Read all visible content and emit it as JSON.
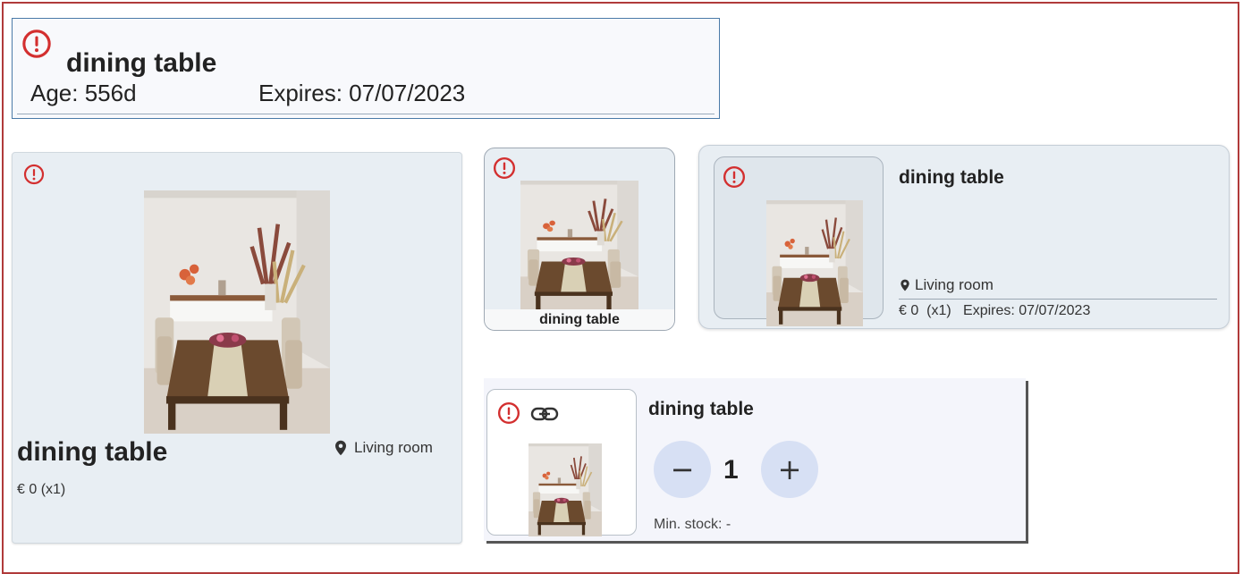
{
  "colors": {
    "alert": "#d32f2f",
    "accent": "#d7e0f4"
  },
  "header": {
    "title": "dining table",
    "age": "Age: 556d",
    "expires": "Expires: 07/07/2023"
  },
  "card_large": {
    "title": "dining table",
    "location": "Living room",
    "price": "€ 0  (x1)",
    "icons": [
      "alert-icon",
      "location-pin-icon"
    ]
  },
  "card_small": {
    "caption": "dining table",
    "icons": [
      "alert-icon"
    ]
  },
  "card_wide": {
    "title": "dining table",
    "location": "Living room",
    "meta": "€ 0  (x1)   Expires: 07/07/2023",
    "icons": [
      "alert-icon",
      "location-pin-icon"
    ]
  },
  "card_stock": {
    "title": "dining table",
    "decrement": "−",
    "quantity": "1",
    "increment": "+",
    "min_stock": "Min. stock: -",
    "icons": [
      "alert-icon",
      "link-icon"
    ]
  }
}
